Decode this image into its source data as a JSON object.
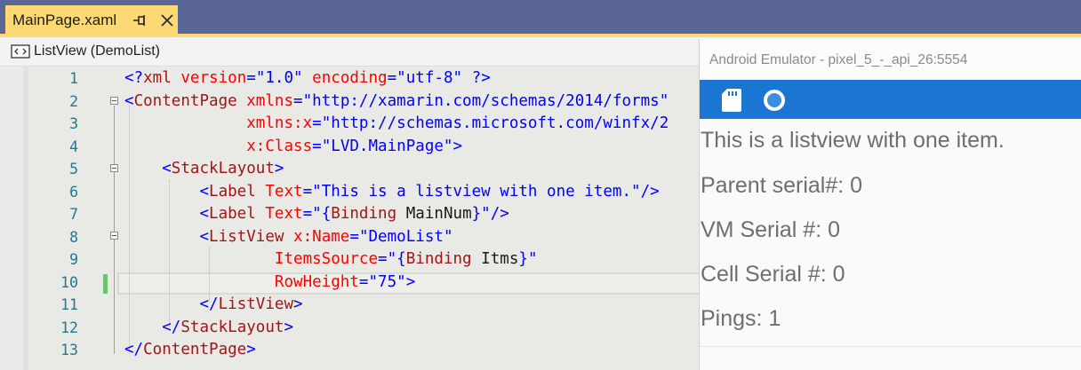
{
  "tab": {
    "filename": "MainPage.xaml"
  },
  "navbar": {
    "label": "ListView (DemoList)"
  },
  "editor": {
    "line_numbers": [
      "1",
      "2",
      "3",
      "4",
      "5",
      "6",
      "7",
      "8",
      "9",
      "10",
      "11",
      "12",
      "13"
    ],
    "lines": [
      {
        "indent": "",
        "tokens": [
          {
            "t": "<?",
            "c": "punc"
          },
          {
            "t": "xml",
            "c": "tag"
          },
          {
            "t": " version",
            "c": "attr"
          },
          {
            "t": "=",
            "c": "punc"
          },
          {
            "t": "\"1.0\"",
            "c": "val"
          },
          {
            "t": " encoding",
            "c": "attr"
          },
          {
            "t": "=",
            "c": "punc"
          },
          {
            "t": "\"utf-8\"",
            "c": "val"
          },
          {
            "t": " ?>",
            "c": "punc"
          }
        ]
      },
      {
        "indent": "",
        "tokens": [
          {
            "t": "<",
            "c": "punc"
          },
          {
            "t": "ContentPage",
            "c": "tag"
          },
          {
            "t": " xmlns",
            "c": "attr"
          },
          {
            "t": "=",
            "c": "punc"
          },
          {
            "t": "\"http://xamarin.com/schemas/2014/forms\"",
            "c": "val"
          }
        ]
      },
      {
        "indent": "             ",
        "tokens": [
          {
            "t": "xmlns:x",
            "c": "attr"
          },
          {
            "t": "=",
            "c": "punc"
          },
          {
            "t": "\"http://schemas.microsoft.com/winfx/2",
            "c": "val"
          }
        ]
      },
      {
        "indent": "             ",
        "tokens": [
          {
            "t": "x:Class",
            "c": "attr"
          },
          {
            "t": "=",
            "c": "punc"
          },
          {
            "t": "\"LVD.MainPage\"",
            "c": "val"
          },
          {
            "t": ">",
            "c": "punc"
          }
        ]
      },
      {
        "indent": "    ",
        "tokens": [
          {
            "t": "<",
            "c": "punc"
          },
          {
            "t": "StackLayout",
            "c": "tag"
          },
          {
            "t": ">",
            "c": "punc"
          }
        ]
      },
      {
        "indent": "        ",
        "tokens": [
          {
            "t": "<",
            "c": "punc"
          },
          {
            "t": "Label",
            "c": "tag"
          },
          {
            "t": " Text",
            "c": "attr"
          },
          {
            "t": "=",
            "c": "punc"
          },
          {
            "t": "\"This is a listview with one item.\"",
            "c": "val"
          },
          {
            "t": "/>",
            "c": "punc"
          }
        ]
      },
      {
        "indent": "        ",
        "tokens": [
          {
            "t": "<",
            "c": "punc"
          },
          {
            "t": "Label",
            "c": "tag"
          },
          {
            "t": " Text",
            "c": "attr"
          },
          {
            "t": "=",
            "c": "punc"
          },
          {
            "t": "\"{",
            "c": "val"
          },
          {
            "t": "Binding",
            "c": "tag"
          },
          {
            "t": " MainNum",
            "c": "bind"
          },
          {
            "t": "}\"",
            "c": "val"
          },
          {
            "t": "/>",
            "c": "punc"
          }
        ]
      },
      {
        "indent": "        ",
        "tokens": [
          {
            "t": "<",
            "c": "punc"
          },
          {
            "t": "ListView",
            "c": "tag"
          },
          {
            "t": " x:Name",
            "c": "attr"
          },
          {
            "t": "=",
            "c": "punc"
          },
          {
            "t": "\"DemoList\"",
            "c": "val"
          }
        ]
      },
      {
        "indent": "                ",
        "tokens": [
          {
            "t": "ItemsSource",
            "c": "attr"
          },
          {
            "t": "=",
            "c": "punc"
          },
          {
            "t": "\"{",
            "c": "val"
          },
          {
            "t": "Binding",
            "c": "tag"
          },
          {
            "t": " Itms",
            "c": "bind"
          },
          {
            "t": "}\"",
            "c": "val"
          }
        ]
      },
      {
        "indent": "                ",
        "tokens": [
          {
            "t": "RowHeight",
            "c": "attr"
          },
          {
            "t": "=",
            "c": "punc"
          },
          {
            "t": "\"75\"",
            "c": "val"
          },
          {
            "t": ">",
            "c": "punc"
          }
        ]
      },
      {
        "indent": "        ",
        "tokens": [
          {
            "t": "</",
            "c": "punc"
          },
          {
            "t": "ListView",
            "c": "tag"
          },
          {
            "t": ">",
            "c": "punc"
          }
        ]
      },
      {
        "indent": "    ",
        "tokens": [
          {
            "t": "</",
            "c": "punc"
          },
          {
            "t": "StackLayout",
            "c": "tag"
          },
          {
            "t": ">",
            "c": "punc"
          }
        ]
      },
      {
        "indent": "",
        "tokens": [
          {
            "t": "</",
            "c": "punc"
          },
          {
            "t": "ContentPage",
            "c": "tag"
          },
          {
            "t": ">",
            "c": "punc"
          }
        ]
      }
    ]
  },
  "emulator": {
    "title": "Android Emulator - pixel_5_-_api_26:5554",
    "labels": [
      "This is a listview with one item.",
      "Parent serial#: 0",
      "VM Serial #: 0",
      "Cell Serial #: 0",
      "Pings: 1"
    ]
  },
  "colors": {
    "tab_active": "#fdd976",
    "status_bar": "#1a76d2",
    "line_numbers": "#237893",
    "change_marker": "#6cc36c"
  },
  "icons": [
    "pin-icon",
    "close-icon",
    "code-nav-icon",
    "sd-card-icon",
    "circle-icon"
  ]
}
